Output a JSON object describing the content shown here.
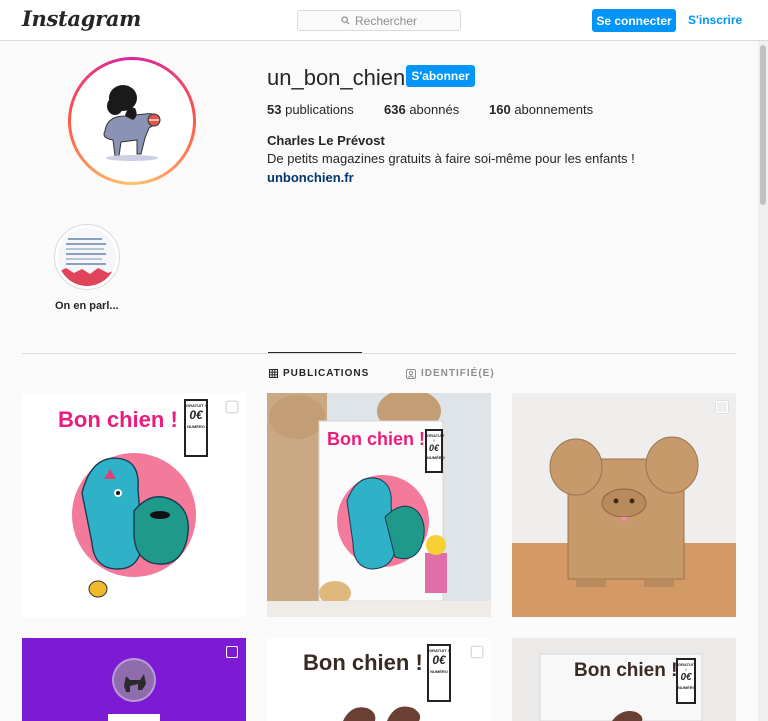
{
  "header": {
    "logo": "Instagram",
    "search_placeholder": "Rechercher",
    "connect_label": "Se connecter",
    "signup_label": "S'inscrire"
  },
  "profile": {
    "username": "un_bon_chien",
    "follow_label": "S'abonner",
    "stats": {
      "posts_count": "53",
      "posts_label": "publications",
      "followers_count": "636",
      "followers_label": "abonnés",
      "following_count": "160",
      "following_label": "abonnements"
    },
    "full_name": "Charles Le Prévost",
    "bio": "De petits magazines gratuits à faire soi-même pour les enfants !",
    "website": "unbonchien.fr"
  },
  "highlights": [
    {
      "label": "On en parl..."
    }
  ],
  "tabs": [
    {
      "label": "PUBLICATIONS",
      "icon": "grid-icon",
      "active": true
    },
    {
      "label": "IDENTIFIÉ(E)",
      "icon": "tagged-user-icon",
      "active": false
    }
  ],
  "posts": [
    {
      "title": "Bon chien !",
      "price": "0€",
      "kind": "magazine-cover"
    },
    {
      "title": "Bon chien !",
      "price": "0€",
      "kind": "magazine-photo"
    },
    {
      "kind": "cardboard-dog"
    },
    {
      "kind": "purple-cover"
    },
    {
      "title": "Bon chien !",
      "price": "0€",
      "kind": "magazine-cover"
    },
    {
      "title": "Bon chien !",
      "price": "0€",
      "kind": "magazine-photo"
    }
  ],
  "magazine": {
    "badge_top": "GRATUIT !",
    "badge_bottom": "NUMÉRO"
  },
  "colors": {
    "accent": "#0095f6",
    "title_pink": "#ec1c7c",
    "purple": "#7d1bd4"
  }
}
